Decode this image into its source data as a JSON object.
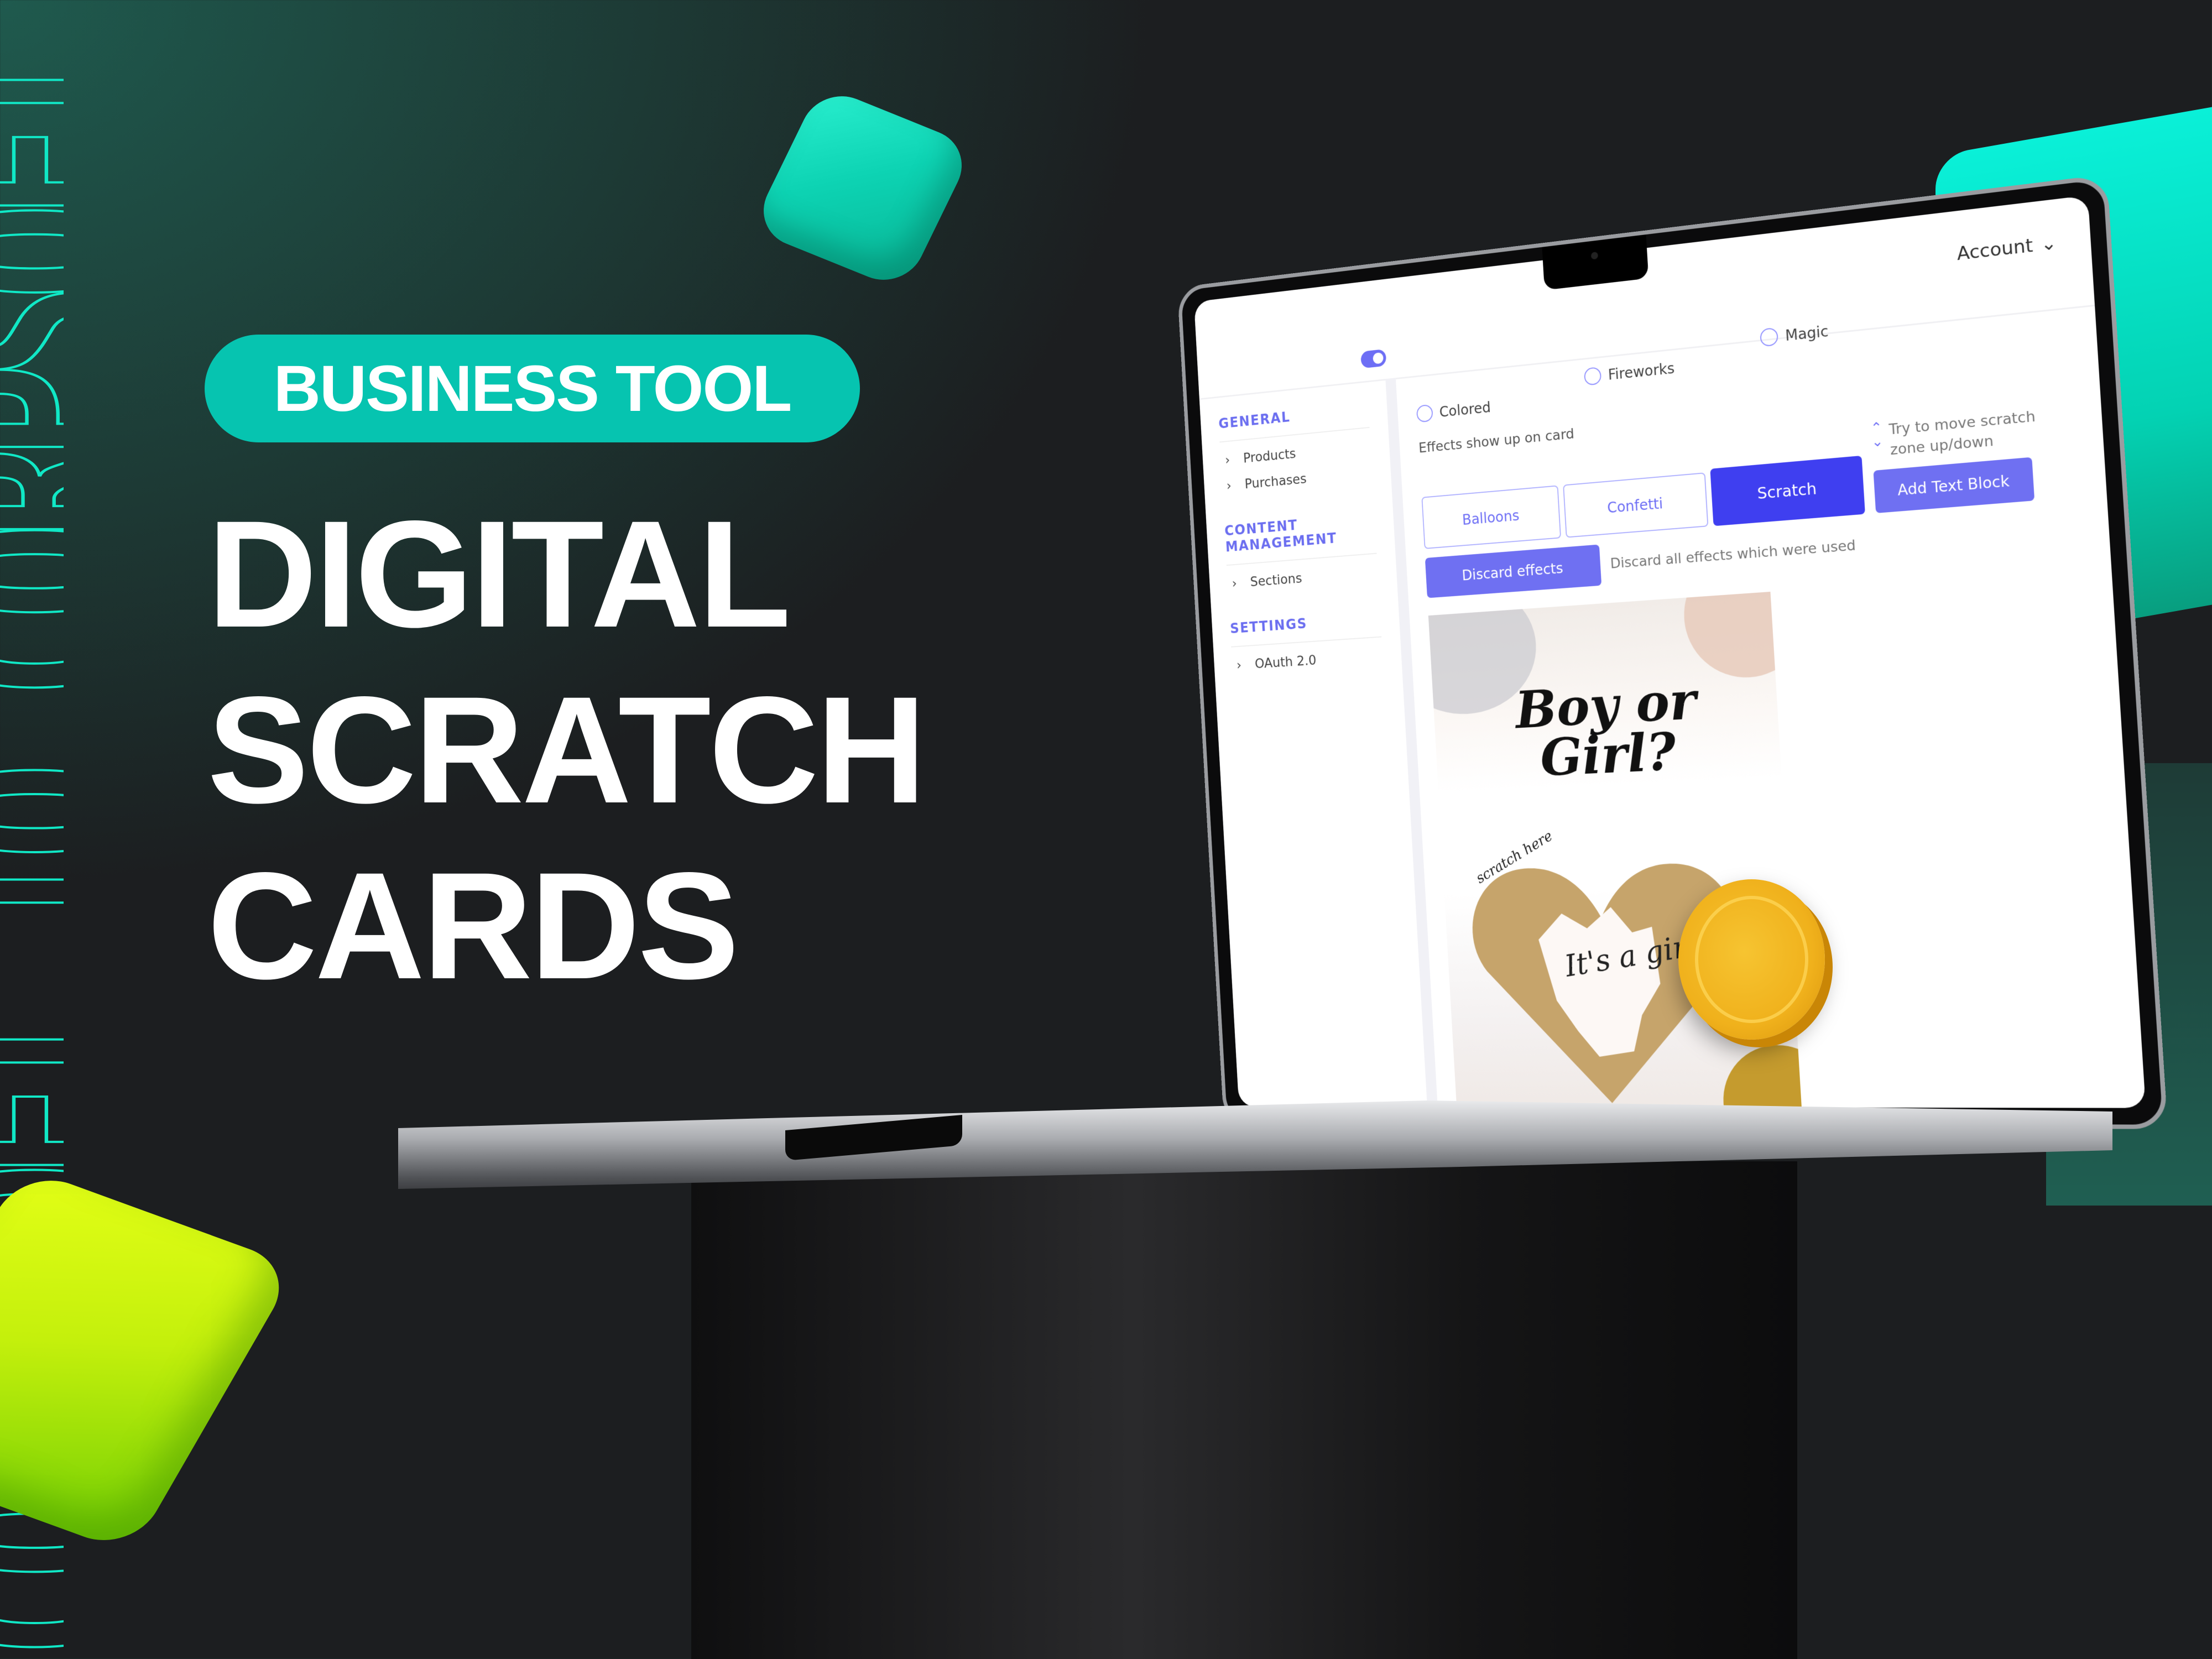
{
  "watermark": {
    "text": "CORPSOFT.IO CORPSOFT.IO"
  },
  "promo": {
    "badge": "BUSINESS TOOL",
    "headline": [
      "DIGITAL",
      "SCRATCH",
      "CARDS"
    ],
    "colors": {
      "accent": "#06c4b0",
      "lime": "#c4f00c",
      "outline": "#10e8c6"
    }
  },
  "app": {
    "account_label": "Account",
    "sidebar": {
      "sections": [
        {
          "title": "GENERAL",
          "items": [
            {
              "label": "Products"
            },
            {
              "label": "Purchases"
            }
          ]
        },
        {
          "title": "CONTENT MANAGEMENT",
          "items": [
            {
              "label": "Sections"
            }
          ]
        },
        {
          "title": "SETTINGS",
          "items": [
            {
              "label": "OAuth 2.0"
            }
          ]
        }
      ]
    },
    "effects_style": {
      "options": [
        {
          "label": "Colored"
        },
        {
          "label": "Fireworks"
        },
        {
          "label": "Magic"
        }
      ]
    },
    "effects_label": "Effects show up on card",
    "effect_tabs": [
      {
        "label": "Balloons",
        "active": false
      },
      {
        "label": "Confetti",
        "active": false
      },
      {
        "label": "Scratch",
        "active": true
      }
    ],
    "scratch_hint": "Try to move scratch zone up/down",
    "add_text_block_label": "Add Text Block",
    "discard_button_label": "Discard effects",
    "discard_hint": "Discard all effects which were used",
    "card": {
      "title_line1": "Boy or",
      "title_line2": "Girl?",
      "scratch_prompt": "scratch here",
      "reveal_text": "It's a girl"
    },
    "colors": {
      "primary": "#3f3ff0",
      "primary_soft": "#6f70f2",
      "section_title": "#6b6ef0"
    }
  }
}
